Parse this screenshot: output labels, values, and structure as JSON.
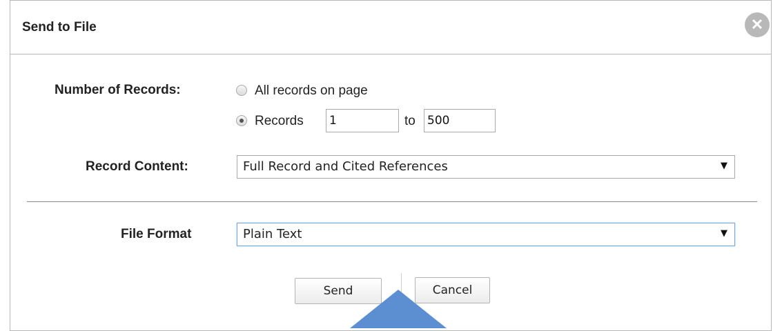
{
  "dialog": {
    "title": "Send to File",
    "close_icon": "close-circle-icon"
  },
  "records": {
    "label": "Number of Records:",
    "option_all": "All records on page",
    "option_range": "Records",
    "selected": "range",
    "from_value": "1",
    "to_label": "to",
    "to_value": "500"
  },
  "content": {
    "label": "Record Content:",
    "selected": "Full Record and Cited References"
  },
  "format": {
    "label": "File Format",
    "selected": "Plain Text"
  },
  "buttons": {
    "send": "Send",
    "cancel": "Cancel"
  },
  "colors": {
    "callout": "#5b8fd2",
    "close_button": "#b8b8b8"
  }
}
